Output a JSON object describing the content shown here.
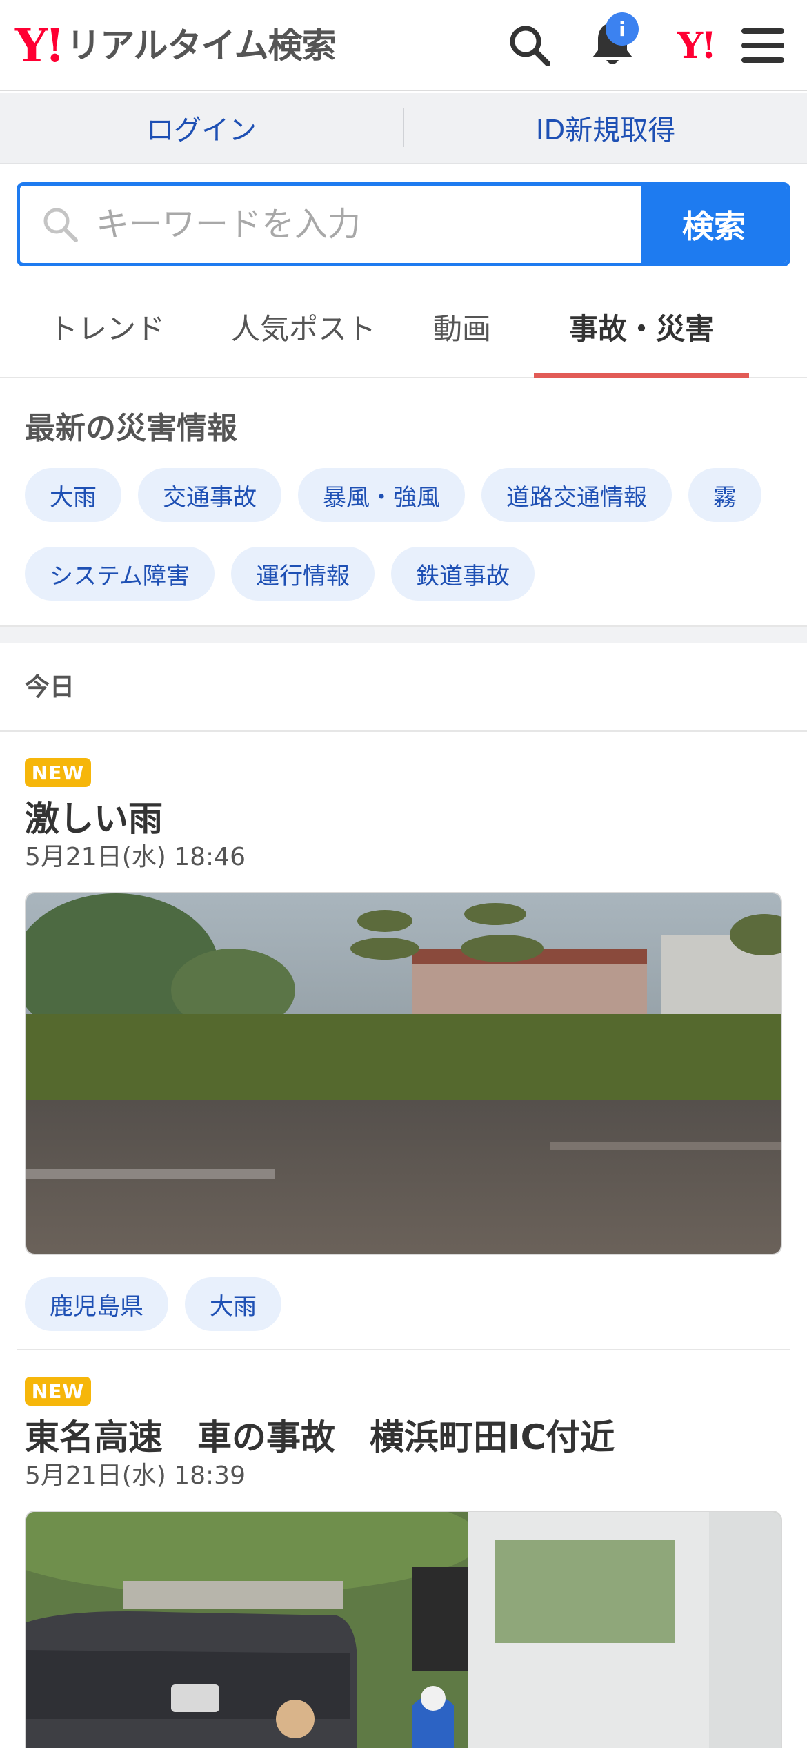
{
  "header": {
    "logo_y": "Y!",
    "logo_text": "リアルタイム検索",
    "notification_badge": "i",
    "yahoo_small": "Y!",
    "icons": [
      "search-icon",
      "bell-icon",
      "yahoo-logo-icon",
      "menu-icon"
    ]
  },
  "loginbar": {
    "login": "ログイン",
    "register": "ID新規取得"
  },
  "search": {
    "placeholder": "キーワードを入力",
    "button": "検索"
  },
  "tabs": [
    {
      "label": "トレンド",
      "active": false
    },
    {
      "label": "人気ポスト",
      "active": false
    },
    {
      "label": "動画",
      "active": false
    },
    {
      "label": "事故・災害",
      "active": true
    }
  ],
  "disaster": {
    "title": "最新の災害情報",
    "chips": [
      "大雨",
      "交通事故",
      "暴風・強風",
      "道路交通情報",
      "霧",
      "システム障害",
      "運行情報",
      "鉄道事故"
    ]
  },
  "today_label": "今日",
  "posts": [
    {
      "badge": "NEW",
      "title": "激しい雨",
      "date": "5月21日(水) 18:46",
      "tags": [
        "鹿児島県",
        "大雨"
      ]
    },
    {
      "badge": "NEW",
      "title": "東名高速　車の事故　横浜町田IC付近",
      "date": "5月21日(水) 18:39",
      "tags": []
    }
  ],
  "colors": {
    "accent_blue": "#1e7bf0",
    "link_blue": "#1e50b4",
    "yahoo_red": "#ff0033",
    "tab_underline": "#e25b56",
    "new_badge": "#f6b60a"
  }
}
